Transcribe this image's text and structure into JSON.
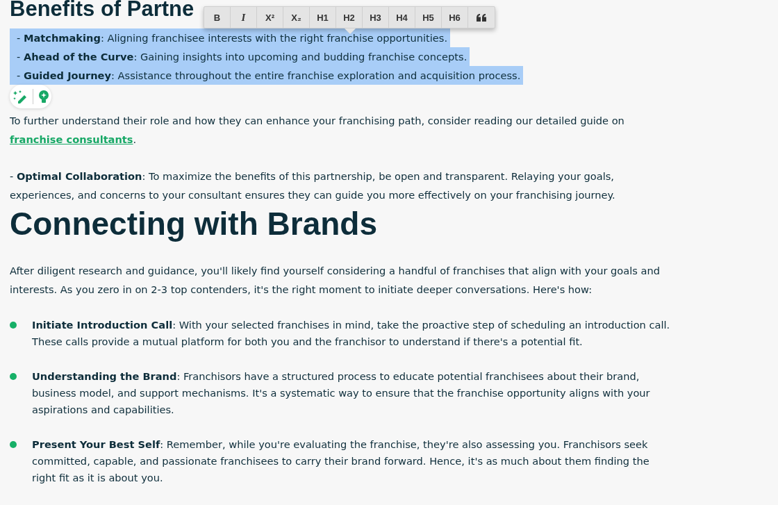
{
  "heading_top": "Benefits of Partne",
  "toolbar": {
    "buttons": [
      {
        "label": "B",
        "kind": "bold"
      },
      {
        "label": "I",
        "kind": "italic"
      },
      {
        "label": "X²",
        "kind": "text"
      },
      {
        "label": "X₂",
        "kind": "text"
      },
      {
        "label": "H1",
        "kind": "text"
      },
      {
        "label": "H2",
        "kind": "text"
      },
      {
        "label": "H3",
        "kind": "text"
      },
      {
        "label": "H4",
        "kind": "text"
      },
      {
        "label": "H5",
        "kind": "text"
      },
      {
        "label": "H6",
        "kind": "text"
      },
      {
        "kind": "quote"
      }
    ]
  },
  "benefits": [
    {
      "text": "- **Matchmaking**: Aligning franchisee interests with the right franchise opportunities.",
      "selected": true
    },
    {
      "text": "- **Ahead of the Curve**: Gaining insights into upcoming and budding franchise concepts.",
      "selected": true
    },
    {
      "text": "- **Guided Journey**: Assistance throughout the entire franchise exploration and acquisition process.",
      "selected": true
    }
  ],
  "guide_paragraph": {
    "text": "To further understand their role and how they can enhance your franchising path, consider reading our detailed guide on",
    "link": "franchise consultants",
    "after": "."
  },
  "collaboration": "- **Optimal Collaboration**: To maximize the benefits of this partnership, be open and transparent. Relaying your goals, experiences, and concerns to your consultant ensures they can guide you more effectively on your franchising journey.",
  "heading": "Connecting with Brands",
  "intro": "After diligent research and guidance, you'll likely find yourself considering a handful of franchises that align with your goals and interests. As you zero in on 2-3 top contenders, it's the right moment to initiate deeper conversations. Here's how:",
  "steps": [
    {
      "text": "**Initiate Introduction Call**: With your selected franchises in mind, take the proactive step of scheduling an introduction call. These calls provide a mutual platform for both you and the franchisor to understand if there's a potential fit."
    },
    {
      "text": "**Understanding the Brand**: Franchisors have a structured process to educate potential franchisees about their brand, business model, and support mechanisms. It's a systematic way to ensure that the franchise opportunity aligns with your aspirations and capabilities."
    },
    {
      "text": "**Present Your Best Self**: Remember, while you're evaluating the franchise, they're also assessing you. Franchisors seek committed, capable, and passionate franchisees to carry their brand forward. Hence, it's as much about them finding the right fit as it is about you."
    }
  ]
}
